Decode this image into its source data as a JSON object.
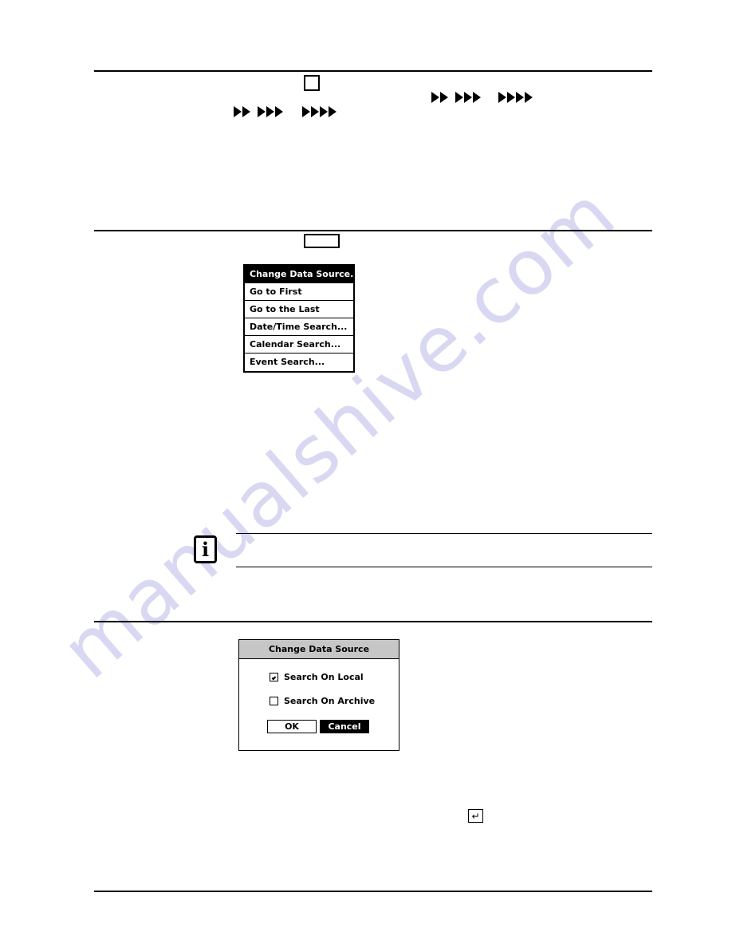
{
  "page": {
    "background_color": "#ffffff",
    "watermark_text": "manualshive.com",
    "watermark_color": "#d8d8f2"
  },
  "keys": {
    "square_key_icon": "blank-square-key-icon",
    "rect_key_icon": "blank-rectangular-key-icon",
    "enter_key_icon": "↵"
  },
  "arrows": {
    "glyph": "▶",
    "groups": [
      {
        "name": "double-arrow",
        "count": 2
      },
      {
        "name": "triple-arrow",
        "count": 3
      },
      {
        "name": "quad-arrow",
        "count": 4
      }
    ]
  },
  "context_menu": {
    "items": [
      {
        "label": "Change Data Source...",
        "selected": true
      },
      {
        "label": "Go to First",
        "selected": false
      },
      {
        "label": "Go to the Last",
        "selected": false
      },
      {
        "label": "Date/Time Search...",
        "selected": false
      },
      {
        "label": "Calendar Search...",
        "selected": false
      },
      {
        "label": "Event Search...",
        "selected": false
      }
    ]
  },
  "note": {
    "icon_glyph": "i",
    "icon_name": "info-icon"
  },
  "dialog": {
    "title": "Change Data Source",
    "title_background": "#c6c6c6",
    "checkboxes": [
      {
        "label": "Search On Local",
        "checked": true
      },
      {
        "label": "Search On Archive",
        "checked": false
      }
    ],
    "buttons": [
      {
        "label": "OK",
        "style": "normal"
      },
      {
        "label": "Cancel",
        "style": "inverted"
      }
    ]
  }
}
